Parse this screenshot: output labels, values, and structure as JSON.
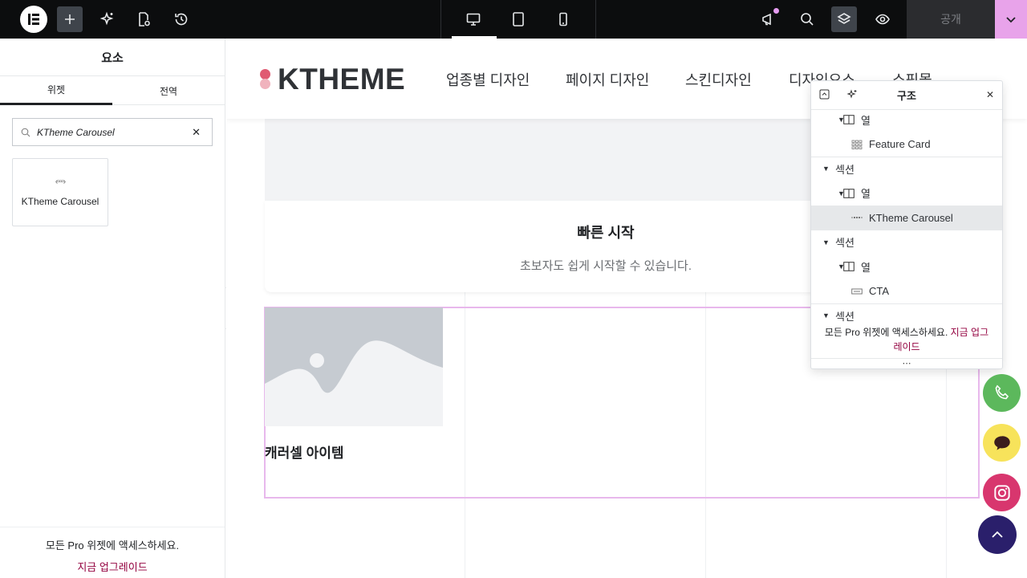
{
  "topbar": {
    "publish_label": "공개"
  },
  "panel": {
    "title": "요소",
    "tabs": [
      {
        "label": "위젯",
        "active": true
      },
      {
        "label": "전역",
        "active": false
      }
    ],
    "search_value": "KTheme Carousel",
    "widget": {
      "label": "KTheme Carousel",
      "icon": "carousel-icon"
    },
    "pro_text": "모든 Pro 위젯에 액세스하세요.",
    "upgrade_text": "지금 업그레이드"
  },
  "site": {
    "brand": "KTHEME",
    "brand_colors": [
      "#e05a72",
      "#f0b3bd"
    ],
    "nav": [
      "업종별 디자인",
      "페이지 디자인",
      "스킨디자인",
      "디자인요소",
      "쇼핑몰"
    ],
    "card_title": "빠른 시작",
    "card_subtitle": "초보자도 쉽게 시작할 수 있습니다.",
    "carousel_item_title": "캐러셀 아이템"
  },
  "navigator": {
    "title": "구조",
    "rows": [
      {
        "caret": true,
        "icon": "column-icon",
        "label": "열",
        "depth": 1
      },
      {
        "caret": false,
        "icon": "grid-icon",
        "label": "Feature Card",
        "depth": 2
      },
      {
        "caret": true,
        "icon": "",
        "label": "섹션",
        "depth": 0
      },
      {
        "caret": true,
        "icon": "column-icon",
        "label": "열",
        "depth": 1
      },
      {
        "caret": false,
        "icon": "carousel-icon",
        "label": "KTheme Carousel",
        "depth": 2,
        "selected": true
      },
      {
        "caret": true,
        "icon": "",
        "label": "섹션",
        "depth": 0
      },
      {
        "caret": true,
        "icon": "column-icon",
        "label": "열",
        "depth": 1
      },
      {
        "caret": false,
        "icon": "cta-icon",
        "label": "CTA",
        "depth": 2
      },
      {
        "caret": true,
        "icon": "",
        "label": "섹션",
        "depth": 0
      }
    ],
    "pro_text": "모든 Pro 위젯에 액세스하세요.",
    "upgrade_text": "지금 업그레이드",
    "more": "⋯"
  },
  "colors": {
    "accent": "#93003f",
    "selection": "#e8b8ec",
    "publish_menu": "#e8a3ea"
  }
}
